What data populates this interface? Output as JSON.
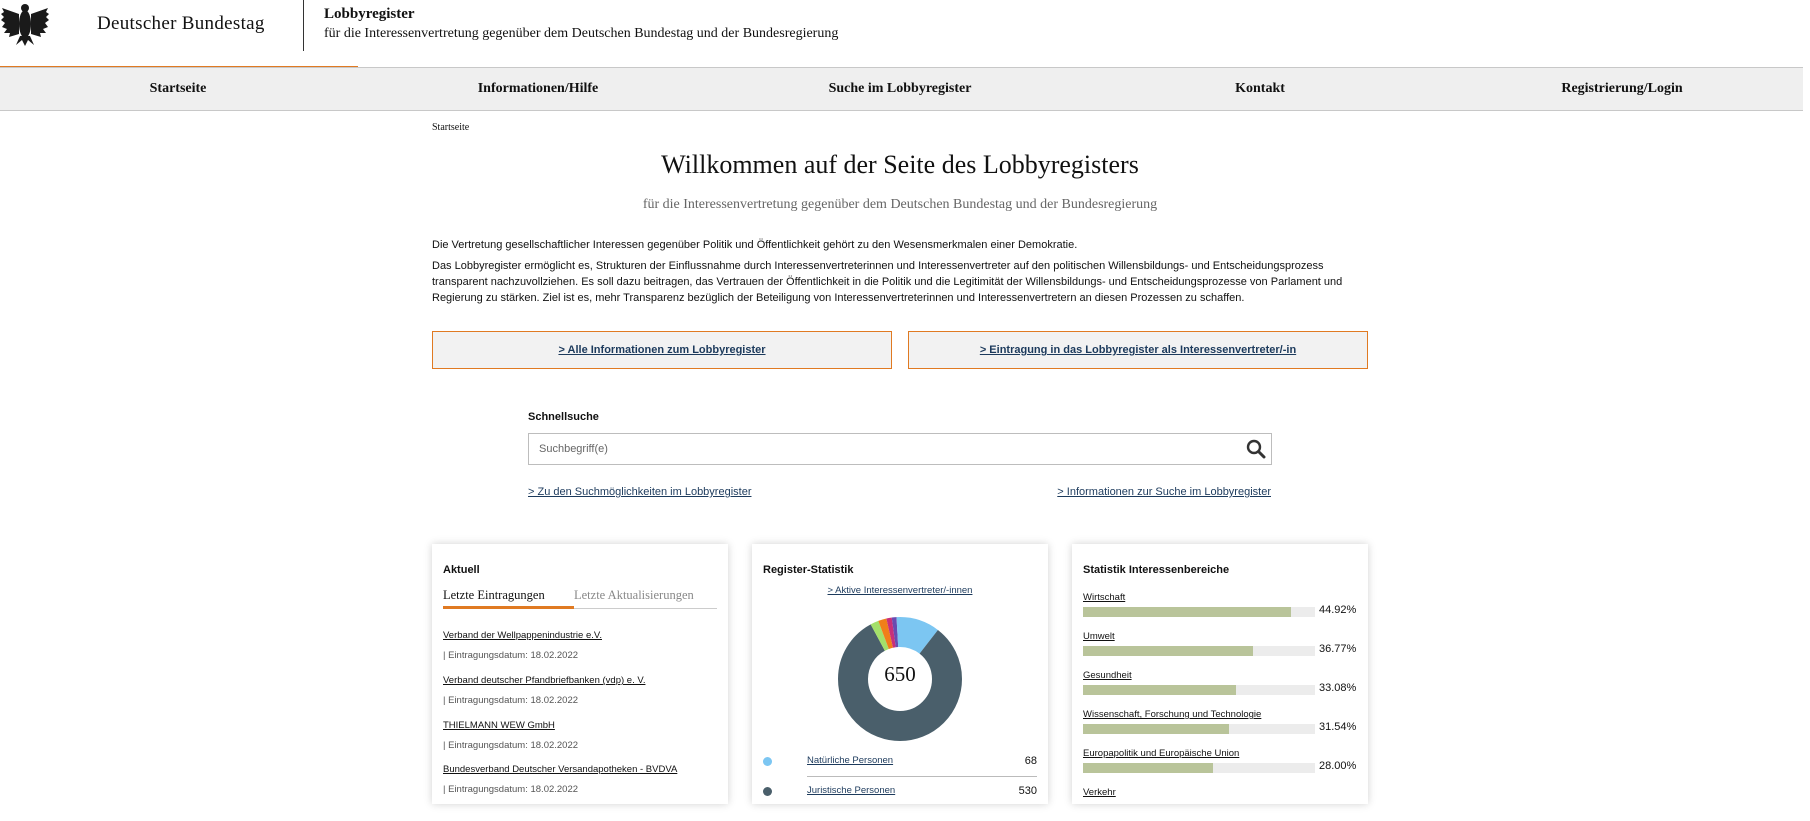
{
  "header": {
    "institution": "Deutscher Bundestag",
    "site_title": "Lobbyregister",
    "site_subtitle": "für die Interessenvertretung gegenüber dem Deutschen Bundestag und der Bundesregierung"
  },
  "nav": {
    "items": [
      {
        "label": "Startseite"
      },
      {
        "label": "Informationen/Hilfe"
      },
      {
        "label": "Suche im Lobbyregister"
      },
      {
        "label": "Kontakt"
      },
      {
        "label": "Registrierung/Login"
      }
    ]
  },
  "breadcrumb": "Startseite",
  "main": {
    "title": "Willkommen auf der Seite des Lobbyregisters",
    "subtitle": "für die Interessenvertretung gegenüber dem Deutschen Bundestag und der Bundesregierung",
    "intro_p1": "Die Vertretung gesellschaftlicher Interessen gegenüber Politik und Öffentlichkeit gehört zu den Wesensmerkmalen einer Demokratie.",
    "intro_p2": "Das Lobbyregister ermöglicht es, Strukturen der Einflussnahme durch Interessenvertreterinnen und Interessenvertreter auf den politischen Willensbildungs- und Entscheidungsprozess transparent nachzuvollziehen. Es soll dazu beitragen, das Vertrauen der Öffentlichkeit in die Politik und die Legitimität der Willensbildungs- und Entscheidungsprozesse von Parlament und Regierung zu stärken. Ziel ist es, mehr Transparenz bezüglich der Beteiligung von Interessenvertreterinnen und Interessenvertretern an diesen Prozessen zu schaffen.",
    "cta_left": "> Alle Informationen zum Lobbyregister",
    "cta_right": "> Eintragung in das Lobbyregister als Interessenvertreter/-in"
  },
  "quicksearch": {
    "label": "Schnellsuche",
    "placeholder": "Suchbegriff(e)",
    "icon": "search-icon",
    "link_left": "> Zu den Suchmöglichkeiten im Lobbyregister",
    "link_right": "> Informationen zur Suche im Lobbyregister"
  },
  "aktuell": {
    "title": "Aktuell",
    "tab_active": "Letzte Eintragungen",
    "tab_inactive": "Letzte Aktualisierungen",
    "entries": [
      {
        "name": "Verband der Wellpappenindustrie e.V.",
        "date": "| Eintragungsdatum: 18.02.2022"
      },
      {
        "name": "Verband deutscher Pfandbriefbanken (vdp) e. V.",
        "date": "| Eintragungsdatum: 18.02.2022"
      },
      {
        "name": "THIELMANN WEW GmbH",
        "date": "| Eintragungsdatum: 18.02.2022"
      },
      {
        "name": "Bundesverband Deutscher Versandapotheken - BVDVA",
        "date": "| Eintragungsdatum: 18.02.2022"
      }
    ]
  },
  "register_stat": {
    "title": "Register-Statistik",
    "link": "> Aktive Interessenvertreter/-innen",
    "total": "650",
    "segments": [
      {
        "value": 68,
        "color": "#7cc6f2"
      },
      {
        "value": 530,
        "color": "#4a5f6b"
      },
      {
        "value": 14,
        "color": "#a4e06a"
      },
      {
        "value": 14,
        "color": "#f07f1a"
      },
      {
        "value": 9,
        "color": "#c8307a"
      },
      {
        "value": 8,
        "color": "#6a4bb0"
      },
      {
        "value": 7,
        "color": "#7cc6f2"
      }
    ],
    "legend": [
      {
        "label": "Natürliche Personen",
        "value": "68",
        "color": "#7cc6f2"
      },
      {
        "label": "Juristische Personen",
        "value": "530",
        "color": "#4a5f6b"
      }
    ]
  },
  "interests": {
    "title": "Statistik Interessenbereiche",
    "items": [
      {
        "label": "Wirtschaft",
        "value": "44.92%",
        "fraction": 0.4492
      },
      {
        "label": "Umwelt",
        "value": "36.77%",
        "fraction": 0.3677
      },
      {
        "label": "Gesundheit",
        "value": "33.08%",
        "fraction": 0.3308
      },
      {
        "label": "Wissenschaft, Forschung und Technologie",
        "value": "31.54%",
        "fraction": 0.3154
      },
      {
        "label": "Europapolitik und Europäische Union",
        "value": "28.00%",
        "fraction": 0.28
      },
      {
        "label": "Verkehr",
        "value": "",
        "fraction": 0
      }
    ]
  },
  "colors": {
    "accent": "#e07a22",
    "link": "#1c3a5c",
    "bar": "#b9c49a"
  }
}
